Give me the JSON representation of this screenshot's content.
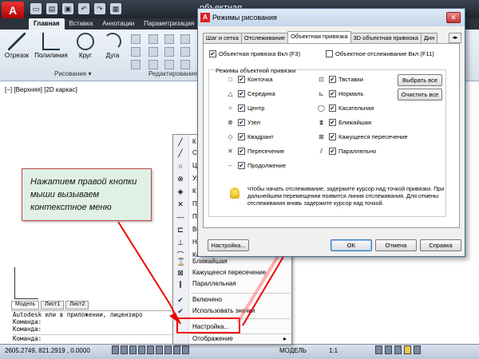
{
  "ribbon": {
    "app_icon": "A",
    "window_title": "объектная",
    "tabs": [
      "Главная",
      "Вставка",
      "Аннотации",
      "Параметризация"
    ],
    "buttons": [
      "Отрезок",
      "Полилиния",
      "Круг",
      "Дуга"
    ],
    "panels": [
      "Рисование",
      "Редактирование"
    ]
  },
  "viewport": {
    "label": "[−] [Верхняя] [2D каркас]"
  },
  "model_tabs": [
    "Модель",
    "Лист1",
    "Лист2"
  ],
  "command": {
    "lines": [
      "Autodesk или в приложении, лицензиро",
      "Команда:",
      "Команда:"
    ],
    "prompt": "Команда:"
  },
  "status": {
    "coords": "2605.2749, 821.2919 , 0.0000",
    "model": "МОДЕЛЬ",
    "scale": "1:1"
  },
  "context_menu": {
    "items": [
      {
        "label": "К",
        "icon": "endpoint-icon"
      },
      {
        "label": "Се",
        "icon": "midpoint-icon"
      },
      {
        "label": "Ц",
        "icon": "center-icon"
      },
      {
        "label": "Уз",
        "icon": "node-icon"
      },
      {
        "label": "К",
        "icon": "quadrant-icon"
      },
      {
        "label": "П",
        "icon": "intersection-icon"
      },
      {
        "label": "П",
        "icon": "extension-icon"
      },
      {
        "label": "Вс",
        "icon": "insertion-icon"
      },
      {
        "label": "Н",
        "icon": "perpendicular-icon"
      },
      {
        "label": "Ка",
        "icon": "tangent-icon"
      },
      {
        "label": "Ближайшая",
        "icon": "nearest-icon"
      },
      {
        "label": "Кажущееся пересечение",
        "icon": "apparent-intersection-icon"
      },
      {
        "label": "Параллельная",
        "icon": "parallel-icon"
      },
      {
        "label": "Включено",
        "icon": "check-icon"
      },
      {
        "label": "Использовать значки",
        "icon": "check-icon"
      },
      {
        "label": "Настройка...",
        "icon": ""
      },
      {
        "label": "Отображение",
        "icon": ""
      }
    ]
  },
  "callout": {
    "text": "Нажатием правой кнопки мыши вызываем контекстное меню"
  },
  "dialog": {
    "title": "Режимы рисования",
    "tabs": [
      "Шаг и сетка",
      "Отслеживание",
      "Объектная привязка",
      "3D объектная привязка",
      "Дин"
    ],
    "snap_on": "Объектная привязка Вкл (F3)",
    "track_on": "Объектное отслеживание Вкл (F11)",
    "group_title": "Режимы объектной привязки",
    "left_modes": [
      "Конточка",
      "Середина",
      "Центр",
      "Узел",
      "Квадрант",
      "Пересечение",
      "Продолжение"
    ],
    "right_modes": [
      "Твставки",
      "Нормаль",
      "Касательная",
      "Ближайшая",
      "Кажущееся пересечение",
      "Параллельно"
    ],
    "select_all": "Выбрать все",
    "clear_all": "Очистить все",
    "hint": "Чтобы начать отслеживание, задержите курсор над точкой привязки. При дальнейшем перемещении появится линия отслеживания. Для отмены отслеживания вновь задержите курсор над точкой.",
    "settings_btn": "Настройка...",
    "ok": "OK",
    "cancel": "Отмена",
    "help": "Справка"
  },
  "colors": {
    "annotation": "#e00000",
    "callout_bg": "#e0f0e6"
  }
}
